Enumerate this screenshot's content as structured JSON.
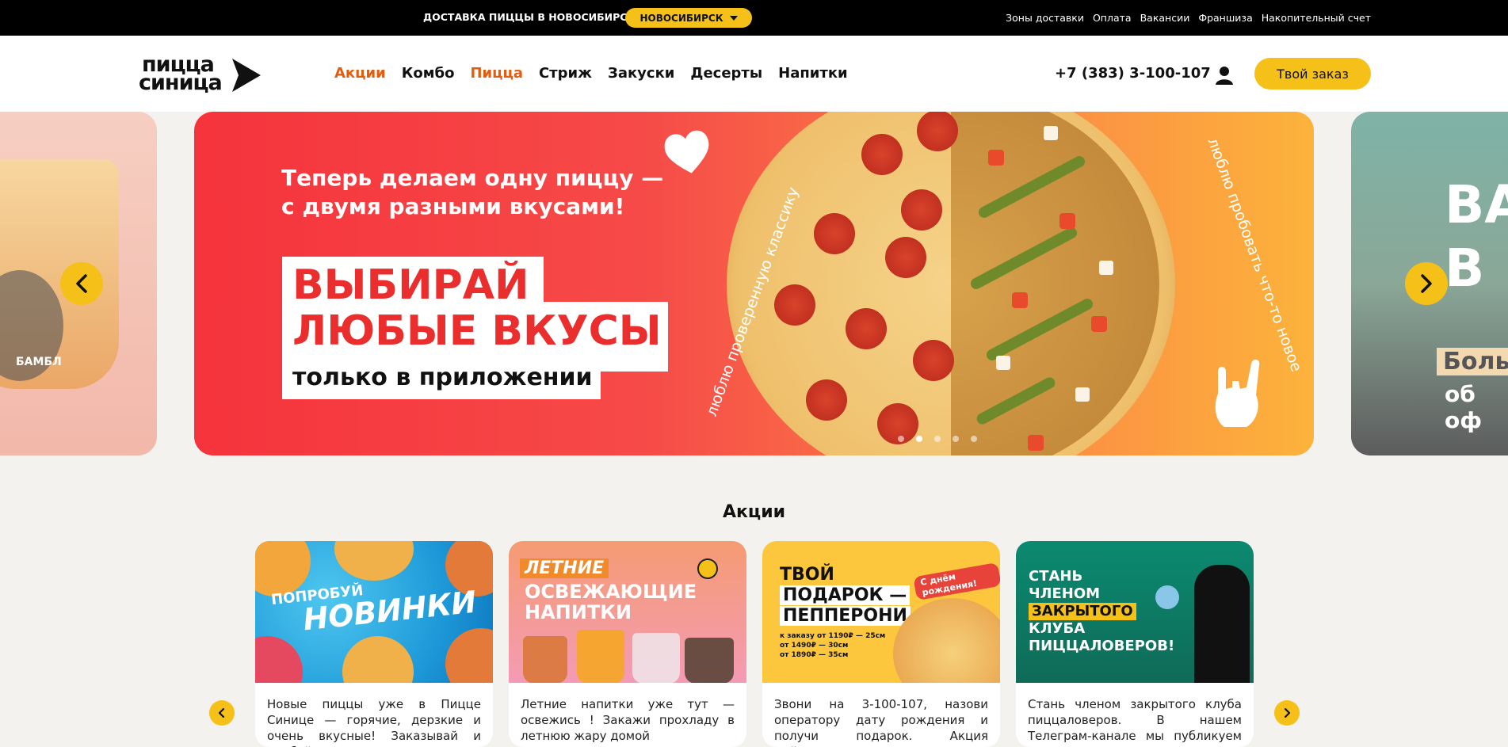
{
  "topbar": {
    "delivery_text": "ДОСТАВКА ПИЦЦЫ В НОВОСИБИРСКЕ",
    "city": "НОВОСИБИРСК",
    "links": [
      "Зоны доставки",
      "Оплата",
      "Вакансии",
      "Франшиза",
      "Накопительный счет"
    ]
  },
  "header": {
    "logo_line1": "пицца",
    "logo_line2": "синица",
    "nav": [
      "Акции",
      "Комбо",
      "Пицца",
      "Стриж",
      "Закуски",
      "Десерты",
      "Напитки"
    ],
    "phone": "+7 (383) 3-100-107",
    "order_button": "Твой заказ"
  },
  "carousel": {
    "left_slide_text": "БАМБЛ",
    "main_slide": {
      "subtitle_line1": "Теперь делаем одну пиццу —",
      "subtitle_line2": "с двумя разными вкусами!",
      "headline_line1": "ВЫБИРАЙ",
      "headline_line2": "ЛЮБЫЕ ВКУСЫ",
      "tagline": "только в приложении",
      "arc_left": "люблю проверенную классику",
      "arc_right": "люблю пробовать что-то новое"
    },
    "right_slide": {
      "line1": "ВА",
      "line2": "В",
      "line3": "Боль",
      "line4": "об оф"
    },
    "dots_count": 5,
    "active_dot": 1
  },
  "promos": {
    "title": "Акции",
    "cards": [
      {
        "img_text_1": "ПОПРОБУЙ",
        "img_text_2": "НОВИНКИ",
        "text": "Новые пиццы уже в Пицце Синице — горячие, дерзкие и очень вкусные! Заказывай и пробуй"
      },
      {
        "img_text_1": "ЛЕТНИЕ",
        "img_text_2": "ОСВЕЖАЮЩИЕ",
        "img_text_3": "НАПИТКИ",
        "text": "Летние напитки уже тут — освежись ! Закажи прохладу в летнюю жару домой"
      },
      {
        "img_text_1": "ТВОЙ",
        "img_text_2": "ПОДАРОК —",
        "img_text_3": "ПЕППЕРОНИ",
        "badge": "С днём рождения!",
        "cond1": "к заказу от 1190₽ — 25см",
        "cond2": "от 1490₽ — 30см",
        "cond3": "от 1890₽ — 35см",
        "text": "Звони на 3-100-107, назови оператору дату рождения и получи подарок. Акция действует также"
      },
      {
        "img_text_1": "СТАНЬ",
        "img_text_2": "ЧЛЕНОМ",
        "img_text_3": "ЗАКРЫТОГО",
        "img_text_4": "КЛУБА",
        "img_text_5": "ПИЦЦАЛОВЕРОВ!",
        "text": "Стань членом закрытого клуба пиццаловеров. В нашем Телеграм-канале мы публикуем секретные"
      }
    ]
  },
  "colors": {
    "accent": "#f5c018",
    "nav_highlight": "#e35d0f",
    "topbar_bg": "#000000",
    "page_bg": "#f3f2ee"
  },
  "icons": [
    "chevron-down-icon",
    "user-icon",
    "chevron-left-icon",
    "chevron-right-icon",
    "heart-icon",
    "rock-hand-icon"
  ]
}
